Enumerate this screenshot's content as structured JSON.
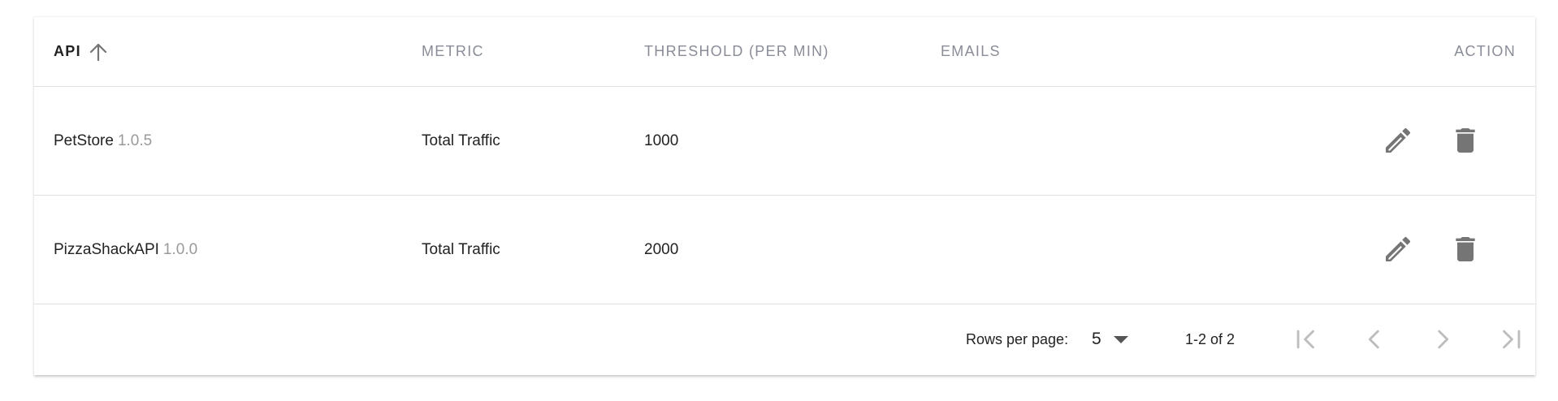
{
  "table": {
    "headers": {
      "api": "API",
      "metric": "METRIC",
      "threshold": "THRESHOLD (PER MIN)",
      "emails": "EMAILS",
      "action": "ACTION"
    },
    "sort": {
      "column": "API",
      "direction": "ascending",
      "icon": "arrow-up-icon"
    },
    "rows": [
      {
        "api_name": "PetStore",
        "api_version": "1.0.5",
        "metric": "Total Traffic",
        "threshold": "1000",
        "emails": ""
      },
      {
        "api_name": "PizzaShackAPI",
        "api_version": "1.0.0",
        "metric": "Total Traffic",
        "threshold": "2000",
        "emails": ""
      }
    ],
    "row_actions": [
      "pencil-icon",
      "trash-icon"
    ]
  },
  "pagination": {
    "rows_per_page_label": "Rows per page:",
    "rows_per_page_value": "5",
    "range": "1-2 of 2",
    "buttons": [
      "first-page-icon",
      "prev-page-icon",
      "next-page-icon",
      "last-page-icon"
    ]
  },
  "colors": {
    "header_text": "#8a8d98",
    "version_text": "#9a9a9a",
    "icon": "#757575",
    "icon_disabled": "#bdbdbd",
    "divider": "#e0e0e0"
  }
}
